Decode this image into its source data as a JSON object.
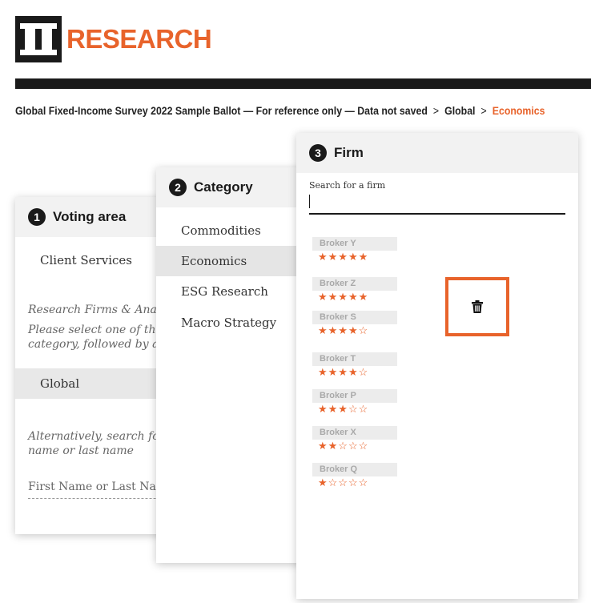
{
  "header": {
    "logo_mark": "II",
    "logo_text": "RESEARCH"
  },
  "breadcrumb": {
    "survey": "Global Fixed-Income Survey 2022 Sample Ballot — For reference only — Data not saved",
    "separator": ">",
    "region": "Global",
    "current": "Economics"
  },
  "voting_area": {
    "number": "1",
    "title": "Voting area",
    "option": "Client Services",
    "help_title": "Research Firms & Analysts",
    "help_line1": "Please select one of the following",
    "help_line2": "category, followed by a firm",
    "selected": "Global",
    "alt_line1": "Alternatively,  search  for an analyst by first",
    "alt_line2": "name or last name",
    "name_placeholder": "First Name or Last Name"
  },
  "category": {
    "number": "2",
    "title": "Category",
    "items": [
      {
        "label": "Commodities",
        "selected": false
      },
      {
        "label": "Economics",
        "selected": true
      },
      {
        "label": "ESG Research",
        "selected": false
      },
      {
        "label": "Macro Strategy",
        "selected": false
      }
    ]
  },
  "firm": {
    "number": "3",
    "title": "Firm",
    "search_label": "Search for a firm",
    "search_value": "",
    "firms": [
      {
        "name": "Broker Y",
        "rating": 5,
        "stars": "★★★★★"
      },
      {
        "name": "Broker Z",
        "rating": 5,
        "stars": "★★★★★"
      },
      {
        "name": "Broker S",
        "rating": 4,
        "stars": "★★★★☆"
      },
      {
        "name": "Broker T",
        "rating": 4,
        "stars": "★★★★☆"
      },
      {
        "name": "Broker P",
        "rating": 3,
        "stars": "★★★☆☆"
      },
      {
        "name": "Broker X",
        "rating": 2,
        "stars": "★★☆☆☆"
      },
      {
        "name": "Broker Q",
        "rating": 1,
        "stars": "★☆☆☆☆"
      }
    ],
    "delete_icon": "trash-icon"
  },
  "colors": {
    "accent": "#e8632b",
    "dark": "#1a1a1a",
    "selected_bg": "#e5e5e5"
  }
}
